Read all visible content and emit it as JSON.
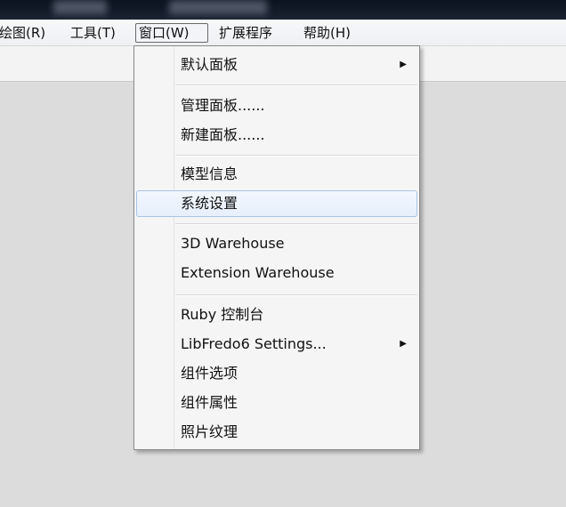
{
  "menubar": {
    "items": [
      {
        "label": "绘图(R)"
      },
      {
        "label": "工具(T)"
      },
      {
        "label": "窗口(W)"
      },
      {
        "label": "扩展程序"
      },
      {
        "label": "帮助(H)"
      }
    ]
  },
  "window_menu": {
    "items": [
      {
        "label": "默认面板",
        "submenu_arrow": "▶"
      },
      {
        "label": "管理面板......"
      },
      {
        "label": "新建面板......"
      },
      {
        "label": "模型信息"
      },
      {
        "label": "系统设置"
      },
      {
        "label": "3D Warehouse"
      },
      {
        "label": "Extension Warehouse"
      },
      {
        "label": "Ruby 控制台"
      },
      {
        "label": "LibFredo6 Settings...",
        "submenu_arrow": "▶"
      },
      {
        "label": "组件选项"
      },
      {
        "label": "组件属性"
      },
      {
        "label": "照片纹理"
      }
    ]
  },
  "colors": {
    "hover_border": "#a9c3e4",
    "hover_fill": "#e6effb",
    "workspace": "#dcdcdc"
  }
}
